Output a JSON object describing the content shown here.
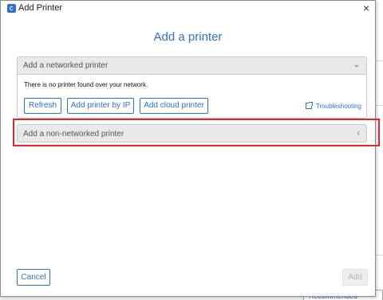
{
  "window": {
    "title": "Add Printer",
    "close_label": "×"
  },
  "heading": "Add a printer",
  "networked": {
    "header": "Add a networked printer",
    "chevron": "⌄",
    "message": "There is no printer found over your network.",
    "refresh_label": "Refresh",
    "add_by_ip_label": "Add printer by IP",
    "add_cloud_label": "Add cloud printer",
    "troubleshooting_label": "Troubleshooting"
  },
  "non_networked": {
    "header": "Add a non-networked printer",
    "chevron": "‹"
  },
  "footer": {
    "cancel_label": "Cancel",
    "add_label": "Add"
  },
  "background": {
    "recommended_label": "Recommended"
  },
  "colors": {
    "accent": "#2f6fd8",
    "highlight": "#e3262b"
  }
}
